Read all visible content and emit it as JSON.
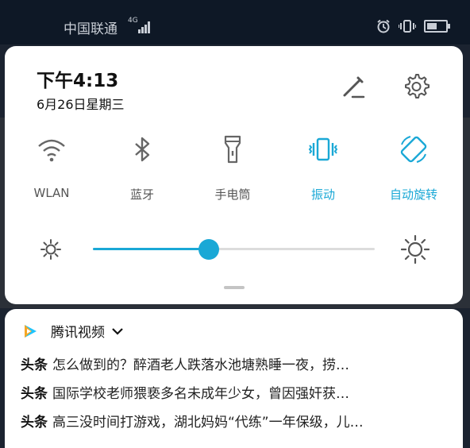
{
  "status_bar": {
    "carrier": "中国联通",
    "network_type": "4G"
  },
  "panel": {
    "time": "下午4:13",
    "date": "6月26日星期三",
    "tiles": [
      {
        "label": "WLAN",
        "icon": "wifi-icon",
        "active": false
      },
      {
        "label": "蓝牙",
        "icon": "bluetooth-icon",
        "active": false
      },
      {
        "label": "手电筒",
        "icon": "flashlight-icon",
        "active": false
      },
      {
        "label": "振动",
        "icon": "vibrate-icon",
        "active": true
      },
      {
        "label": "自动旋转",
        "icon": "auto-rotate-icon",
        "active": true
      }
    ],
    "brightness_level": 0.41
  },
  "notification": {
    "app_name": "腾讯视频",
    "items": [
      {
        "tag": "头条",
        "text": "怎么做到的？醉酒老人跌落水池塘熟睡一夜，捞…"
      },
      {
        "tag": "头条",
        "text": "国际学校老师猥亵多名未成年少女，曾因强奸获…"
      },
      {
        "tag": "头条",
        "text": "高三没时间打游戏，湖北妈妈“代练”一年保级，儿…"
      }
    ]
  },
  "colors": {
    "accent": "#1aa8d6",
    "inactive_icon": "#666666",
    "background": "#1b2330"
  }
}
